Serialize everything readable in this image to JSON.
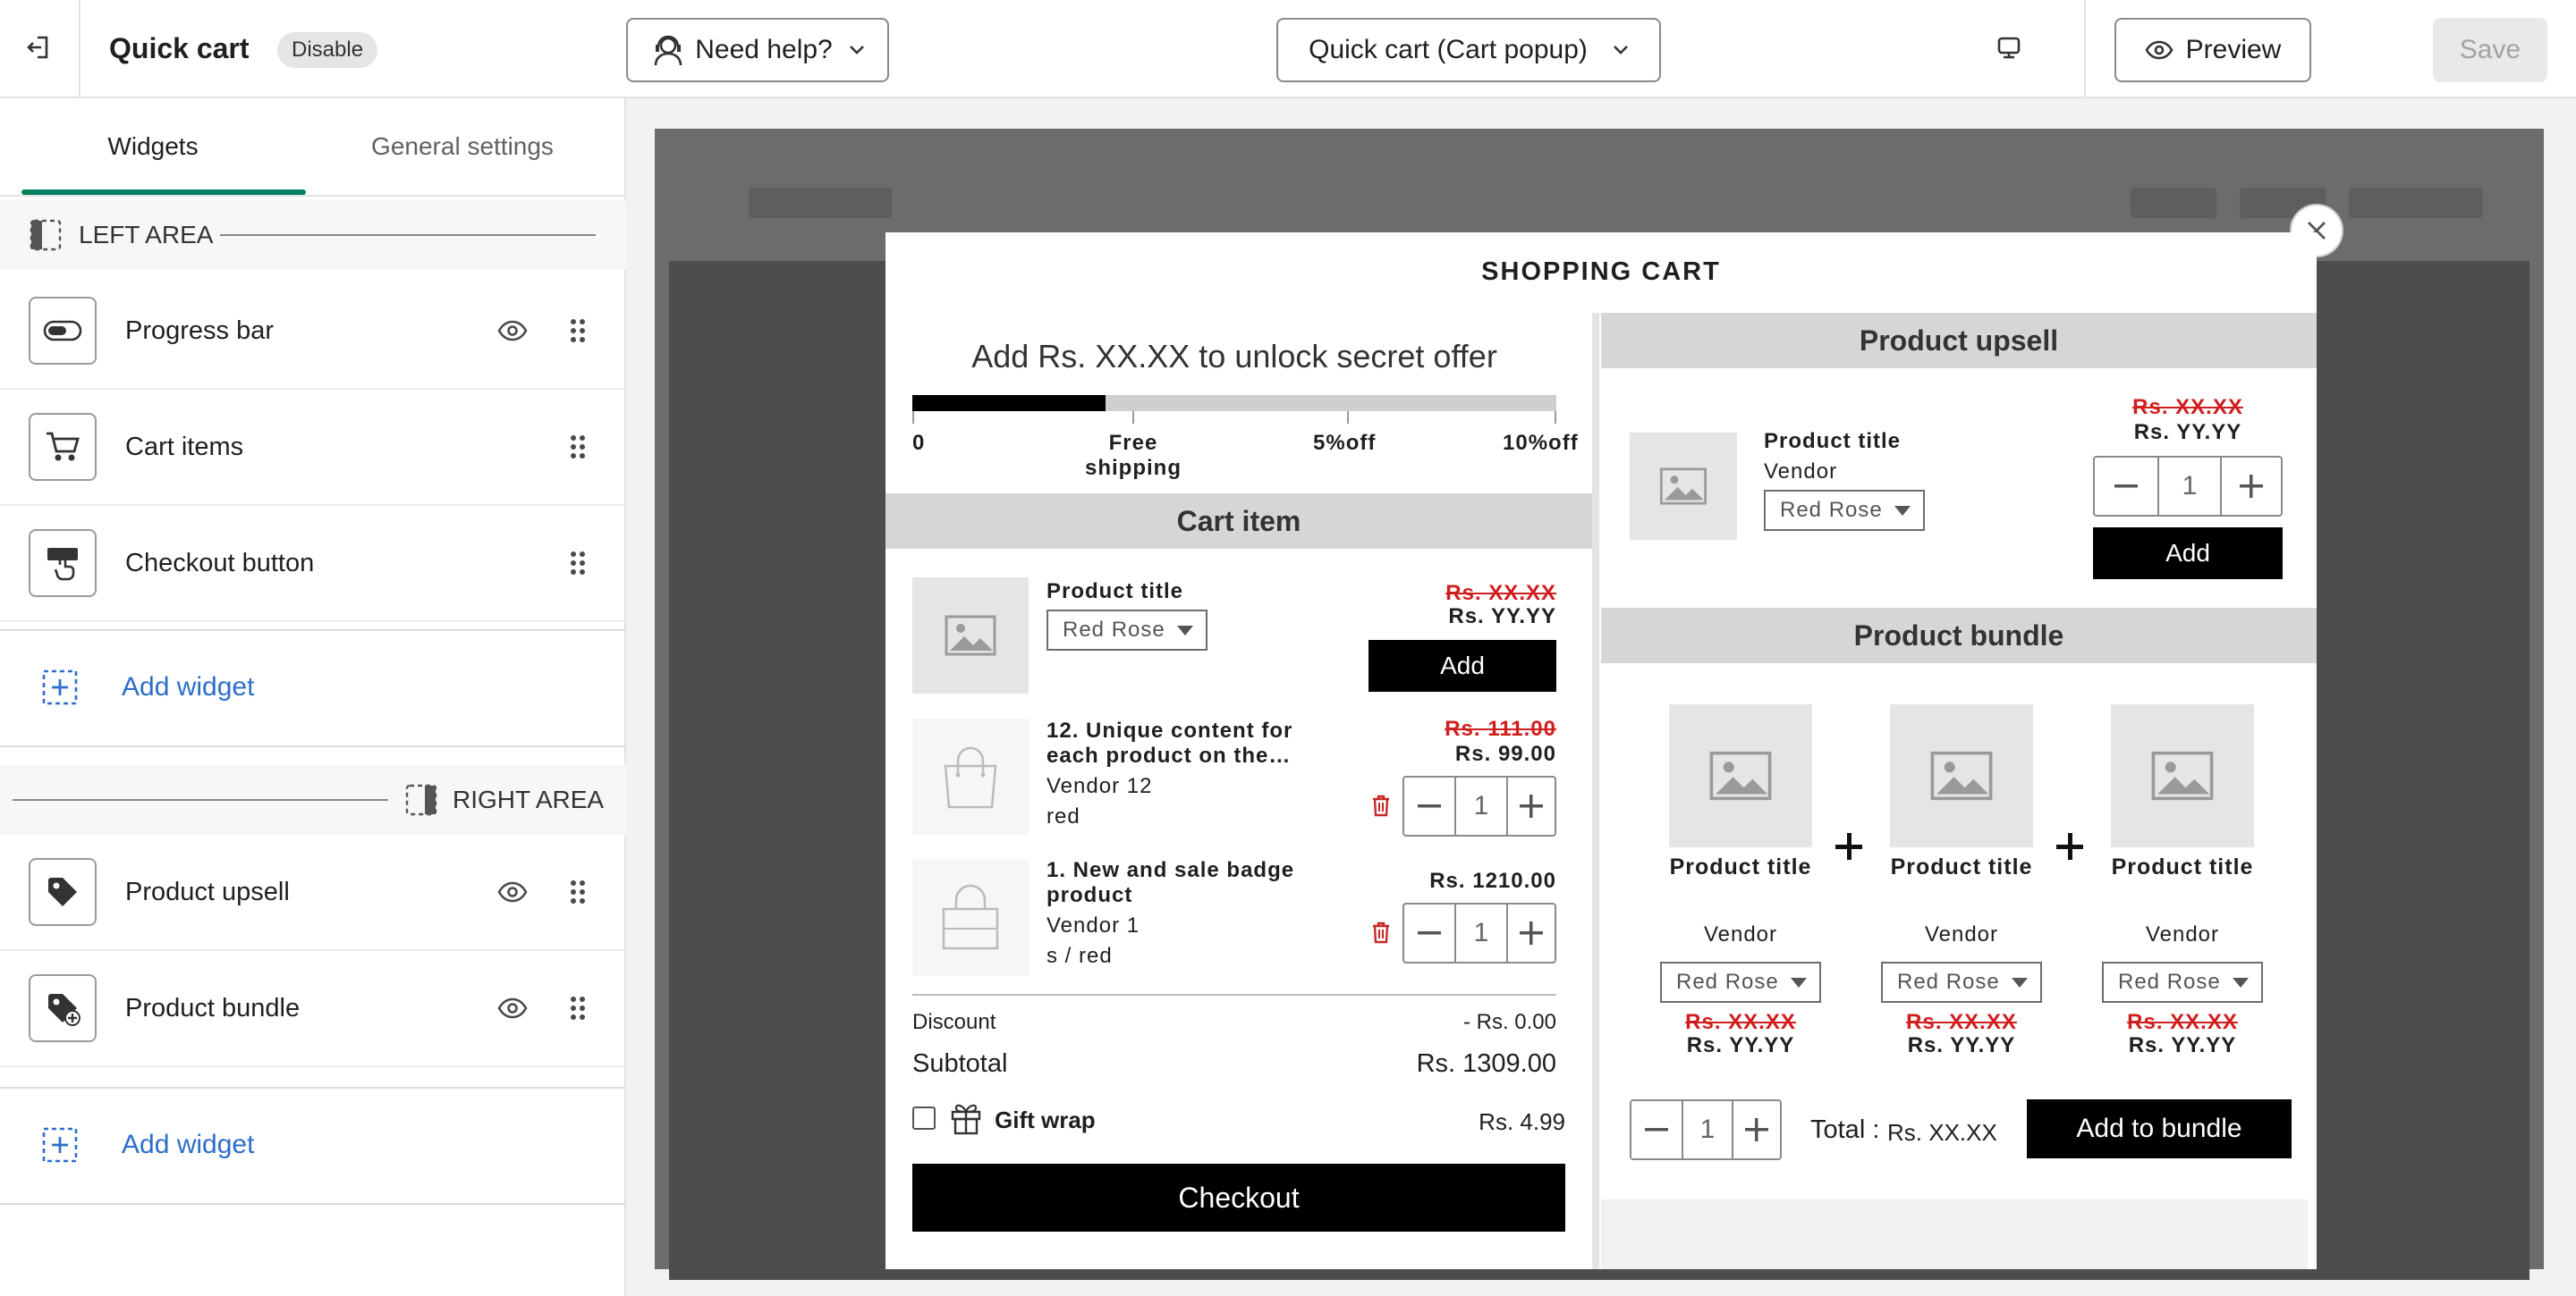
{
  "topbar": {
    "title": "Quick cart",
    "status_badge": "Disable",
    "help_label": "Need help?",
    "template_select": "Quick cart (Cart popup)",
    "preview_label": "Preview",
    "save_label": "Save"
  },
  "sidebar": {
    "tabs": [
      "Widgets",
      "General settings"
    ],
    "left_area_label": "LEFT AREA",
    "right_area_label": "RIGHT AREA",
    "left_widgets": [
      "Progress bar",
      "Cart items",
      "Checkout button"
    ],
    "right_widgets": [
      "Product upsell",
      "Product bundle"
    ],
    "add_widget_label": "Add widget"
  },
  "cart": {
    "title": "SHOPPING CART",
    "progress": {
      "message": "Add Rs. XX.XX to unlock secret offer",
      "fill_fraction": 0.3,
      "milestones": [
        "0",
        "Free shipping",
        "5%off",
        "10%off"
      ]
    },
    "cart_item_heading": "Cart item",
    "items": [
      {
        "title": "Product title",
        "variant": "Red Rose",
        "old_price": "Rs. XX.XX",
        "price": "Rs. YY.YY",
        "action": "Add"
      },
      {
        "title": "12. Unique content for each product on the…",
        "vendor": "Vendor 12",
        "variant": "red",
        "old_price": "Rs. 111.00",
        "price": "Rs. 99.00",
        "qty": "1"
      },
      {
        "title": "1. New and sale badge product",
        "vendor": "Vendor 1",
        "variant": "s / red",
        "price": "Rs. 1210.00",
        "qty": "1"
      }
    ],
    "discount_label": "Discount",
    "discount_value": "- Rs. 0.00",
    "subtotal_label": "Subtotal",
    "subtotal_value": "Rs. 1309.00",
    "gift_label": "Gift wrap",
    "gift_price": "Rs. 4.99",
    "checkout_label": "Checkout"
  },
  "upsell": {
    "heading": "Product upsell",
    "title": "Product title",
    "vendor": "Vendor",
    "variant": "Red Rose",
    "old_price": "Rs. XX.XX",
    "price": "Rs. YY.YY",
    "qty": "1",
    "add_label": "Add"
  },
  "bundle": {
    "heading": "Product bundle",
    "products": [
      {
        "title": "Product title",
        "vendor": "Vendor",
        "variant": "Red Rose",
        "old_price": "Rs. XX.XX",
        "price": "Rs. YY.YY"
      },
      {
        "title": "Product title",
        "vendor": "Vendor",
        "variant": "Red Rose",
        "old_price": "Rs. XX.XX",
        "price": "Rs. YY.YY"
      },
      {
        "title": "Product title",
        "vendor": "Vendor",
        "variant": "Red Rose",
        "old_price": "Rs. XX.XX",
        "price": "Rs. YY.YY"
      }
    ],
    "qty": "1",
    "total_label": "Total :",
    "total_value": "Rs. XX.XX",
    "add_label": "Add to bundle"
  },
  "colors": {
    "accent": "#2c6ecb",
    "tab_underline": "#008060",
    "strike_price": "#d01d1d",
    "trash": "#c62828"
  }
}
